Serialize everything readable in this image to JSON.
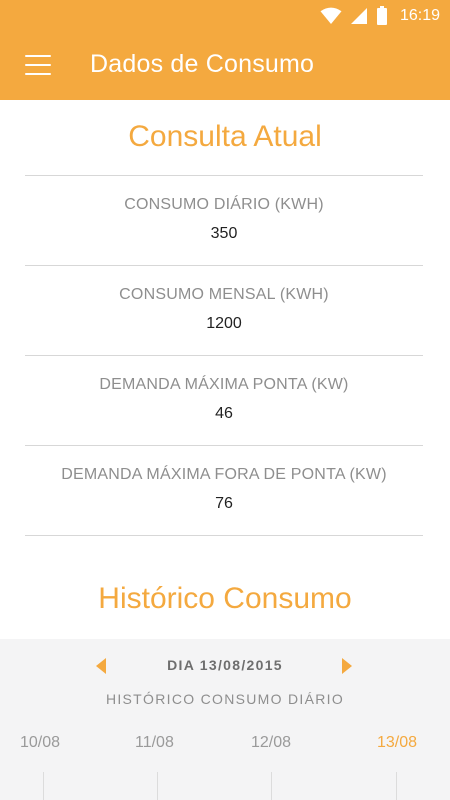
{
  "status_bar": {
    "time": "16:19"
  },
  "header": {
    "title": "Dados de Consumo"
  },
  "current": {
    "title": "Consulta Atual",
    "metrics": [
      {
        "label": "CONSUMO DIÁRIO (KWH)",
        "value": "350"
      },
      {
        "label": "CONSUMO MENSAL (KWH)",
        "value": "1200"
      },
      {
        "label": "DEMANDA MÁXIMA PONTA (KW)",
        "value": "46"
      },
      {
        "label": "DEMANDA MÁXIMA FORA DE PONTA (KW)",
        "value": "76"
      }
    ]
  },
  "history": {
    "title": "Histórico Consumo",
    "day_label": "DIA 13/08/2015",
    "subtitle": "HISTÓRICO CONSUMO DIÁRIO",
    "dates": [
      "10/08",
      "11/08",
      "12/08",
      "13/08"
    ],
    "selected_index": 3
  },
  "colors": {
    "accent": "#f4a93f",
    "panel_bg": "#f4f4f5"
  },
  "icons": [
    "menu-icon",
    "wifi-icon",
    "signal-icon",
    "battery-icon",
    "chevron-left-icon",
    "chevron-right-icon"
  ]
}
